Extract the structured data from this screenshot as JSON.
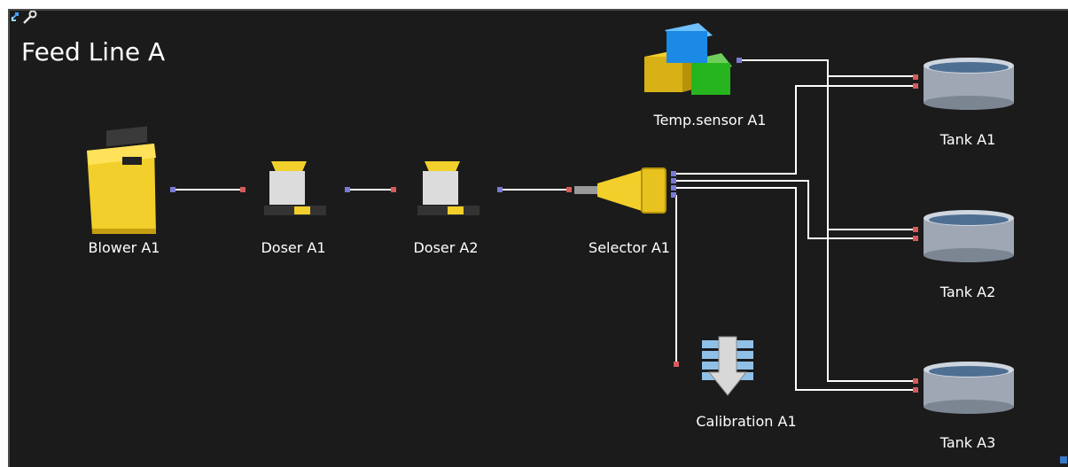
{
  "title": "Feed Line A",
  "nodes": {
    "blower": "Blower A1",
    "doser1": "Doser A1",
    "doser2": "Doser A2",
    "selector": "Selector A1",
    "temp": "Temp.sensor A1",
    "calibration": "Calibration A1",
    "tank1": "Tank A1",
    "tank2": "Tank A2",
    "tank3": "Tank A3"
  },
  "colors": {
    "background": "#1b1b1b",
    "wire": "#ffffff",
    "port_out": "#7a7ad6",
    "port_in": "#d65a5a",
    "device_yellow": "#f2cf2a"
  },
  "icons": {
    "tools": [
      "refresh-arrows-icon",
      "wrench-icon"
    ],
    "corner": "resize-icon"
  }
}
